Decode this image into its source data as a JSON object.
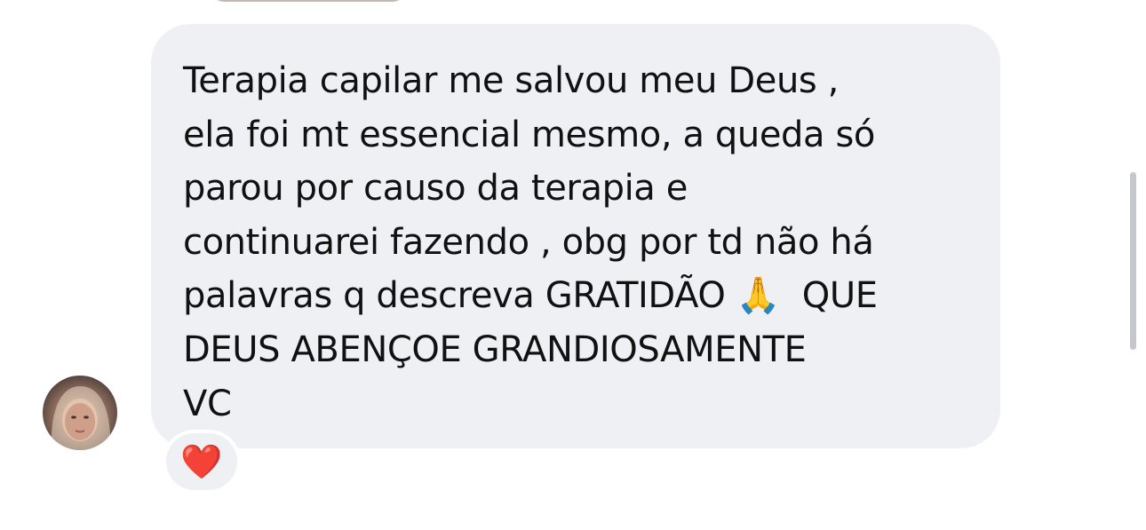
{
  "message": {
    "lines": [
      "Terapia capilar me salvou meu Deus ,",
      "ela foi mt essencial mesmo, a queda só",
      "parou por causo da terapia e",
      "continuarei fazendo , obg por td não há",
      "palavras q descreva GRATIDÃO 🙏  QUE",
      "DEUS ABENÇOE GRANDIOSAMENTE",
      "VC"
    ],
    "text": "Terapia capilar me salvou meu Deus ,\nela foi mt essencial mesmo, a queda só\nparou por causo da terapia e\ncontinuarei fazendo , obg por td não há\npalavras q descreva GRATIDÃO 🙏  QUE\nDEUS ABENÇOE GRANDIOSAMENTE\nVC"
  },
  "reaction": {
    "emoji": "❤️",
    "icon": "heart-icon",
    "color": "#e0141e"
  },
  "colors": {
    "bubble_background": "#eff0f4",
    "text": "#111111",
    "page_background": "#ffffff"
  }
}
